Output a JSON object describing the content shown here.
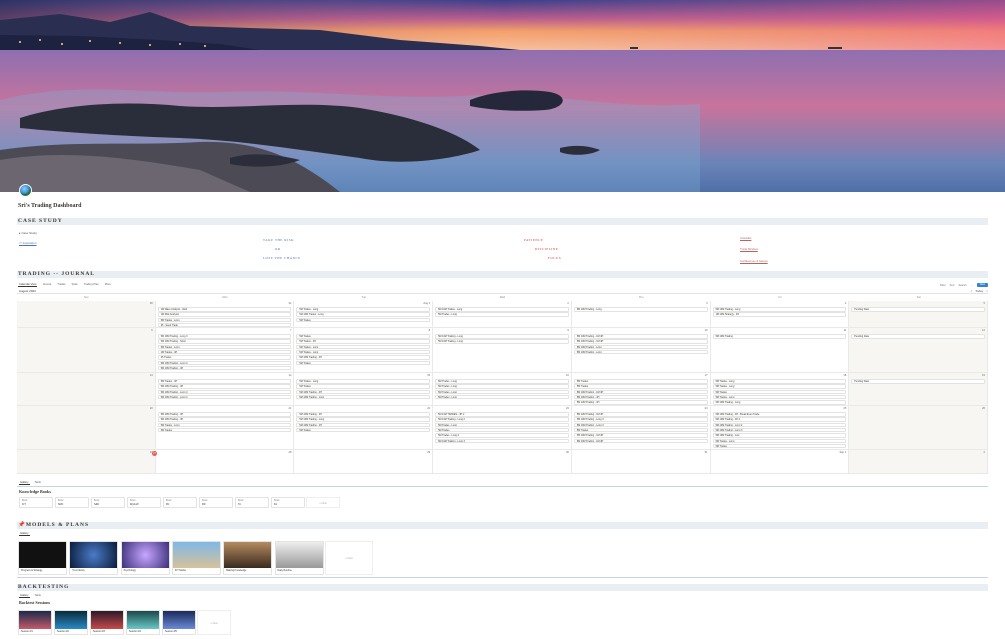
{
  "page": {
    "title": "Sri's Trading Dashboard",
    "icon": "globe-icon"
  },
  "case_study": {
    "heading": "CASE STUDY",
    "toggle": "Case Study",
    "link": "Inspiration"
  },
  "quotes_left": [
    "TAKE THE RISK",
    "OR",
    "LOSE THE CHANCE"
  ],
  "quotes_right": [
    "PATIENCE",
    "DISCIPLINE",
    "FOCUS"
  ],
  "links_right": [
    "Checklist",
    "Trade Mindset",
    "Confluences & Setups"
  ],
  "journal": {
    "heading": "TRADING -- JOURNAL",
    "tabs": [
      "Calendar View",
      "Journal",
      "Trades",
      "Stats",
      "Trading Plan",
      "More"
    ],
    "toolbar": [
      "Filter",
      "Sort",
      "Search",
      "...",
      "New"
    ],
    "month": "August 2023",
    "nav": [
      "<",
      "Today",
      ">"
    ],
    "weekdays": [
      "Sun",
      "Mon",
      "Tue",
      "Wed",
      "Thu",
      "Fri",
      "Sat"
    ],
    "weeks": [
      {
        "days": [
          "30",
          "31",
          "Aug 1",
          "2",
          "3",
          "4",
          "5"
        ],
        "events": [
          [],
          [
            "1M Wave Analysis - Wed",
            "1M Risk Analysis",
            "5M Trades - Long",
            "25 - Seed Trade"
          ],
          [
            "5M Trades - Long",
            "5M 10M Trades - Long",
            "5M Trades"
          ],
          [
            "5M 10M Trades - Long",
            "5M Trades - Long"
          ],
          [
            "5M 10M Trading - Long"
          ],
          [
            "5M 10M Trading - Long",
            "1M 10M Strategy - 4H"
          ],
          [
            "Pending Data"
          ]
        ]
      },
      {
        "days": [
          "6",
          "7",
          "8",
          "9",
          "10",
          "11",
          "12"
        ],
        "events": [
          [],
          [
            "5M 10M Trading - Long 3",
            "5M 10M Trading - Short",
            "5M Trades - Long",
            "1M Trades - 4H",
            "25 Trades",
            "5M 10M Trading - Long 4",
            "5M 10M Trading - 4H"
          ],
          [
            "5M Trades",
            "5M Trades - 4H",
            "5M Trades - Long",
            "5M Trades - Long",
            "5M 10M Trading - 4H",
            "5M Trades"
          ],
          [
            "5M 10M Trading - Long",
            "5M 10M Trading - Long"
          ],
          [
            "5M 10M Trading - 1M 4H",
            "5M 10M Trading - 1M 4H",
            "5M 10M Trading - Long",
            "5M 10M Trading - Long"
          ],
          [
            "5M 10M Trading"
          ],
          [
            "Pending Data"
          ]
        ]
      },
      {
        "days": [
          "13",
          "14",
          "15",
          "16",
          "17",
          "18",
          "19"
        ],
        "events": [
          [],
          [
            "5M Trades - 4H",
            "5M 10M Trading - 4H",
            "5M 10M Trading - Long 4",
            "5M 10M Trading - Long 3"
          ],
          [
            "5M Trades - Long",
            "5M Trades",
            "5M 10M Trading - 4H",
            "5M 10M Trading - Long"
          ],
          [
            "5M Trades - Long",
            "5M Trades - Long",
            "5M Trades - Long",
            "5M Trades - Long"
          ],
          [
            "5M Trades",
            "5M Trades",
            "5M 10M Trading - 1M 4H",
            "5M 10M Trading - 4H",
            "5M 10M Trading - 4H"
          ],
          [
            "5M Trades - Long",
            "5M Trades - Long",
            "5M Trades",
            "5M Trades - Long",
            "5M 10M Trading - Long"
          ],
          [
            "Pending Data"
          ]
        ]
      },
      {
        "days": [
          "20",
          "21",
          "22",
          "23",
          "24",
          "25",
          "26"
        ],
        "events": [
          [],
          [
            "5M 10M Trading - 4H",
            "5M 10M Trading - 4H",
            "5M Trades - Long",
            "5M Trades"
          ],
          [
            "5M 10M Trading - 4H",
            "5M 10M Trading - Long",
            "5M 10M Trading - 4H",
            "5M Trades"
          ],
          [
            "5M 10M TRADES - 4H 2",
            "5M 10M Trading - Long 2",
            "5M Trades - Long",
            "5M Trades",
            "5M Trades - Long 4",
            "5M 10M Trading - Long 3"
          ],
          [
            "5M 10M Trading - 1M 4H",
            "5M 10M Trading - Long 3",
            "5M 10M Trading - Long 3",
            "5M Trades",
            "5M 10M Trading - 1M 4H",
            "5M 10M Trading - 1M 4H"
          ],
          [
            "5M 10M Trading - 4H - Break Even Trade",
            "5M 10M Trading - 4H 2",
            "5M 10M Trading - Long 2",
            "5M 10M Trading - Long 3",
            "5M 10M Trading - Low",
            "5M Trades - Long",
            "5M Trades"
          ],
          []
        ]
      },
      {
        "days": [
          "27",
          "28",
          "29",
          "30",
          "31",
          "Sep 1",
          "2"
        ],
        "events": [
          [],
          [],
          [],
          [],
          [],
          [],
          []
        ]
      }
    ]
  },
  "knowledge": {
    "tabs": [
      "Gallery",
      "Table"
    ],
    "heading": "Knowledge Books",
    "boxes": [
      [
        "Book",
        "ICT"
      ],
      [
        "Book",
        "SMC"
      ],
      [
        "Book",
        "S&D"
      ],
      [
        "Book",
        "Wyckoff"
      ],
      [
        "Book",
        "PA"
      ],
      [
        "Book",
        "RD"
      ],
      [
        "Book",
        "TA"
      ],
      [
        "Book",
        "FA"
      ]
    ],
    "new": "+ New"
  },
  "models": {
    "heading": "MODELS & PLANS",
    "tab": "Gallery",
    "cards": [
      "Progress & Strategy",
      "Trend Entry",
      "Psychology",
      "ICT Model",
      "Making Knowledge",
      "Daily Routine"
    ],
    "new": "+ New"
  },
  "backtesting": {
    "heading": "BACKTESTING",
    "tabs": [
      "Gallery",
      "Table"
    ],
    "subheading": "Backtest Sessions",
    "cards": [
      "Session #1",
      "Session #2",
      "Session #3",
      "Session #4",
      "Session #5"
    ],
    "new": "+ New"
  },
  "colors": {
    "accent": "#2f84d6",
    "sectionBg": "#e9eef3",
    "today": "#eb5757"
  }
}
